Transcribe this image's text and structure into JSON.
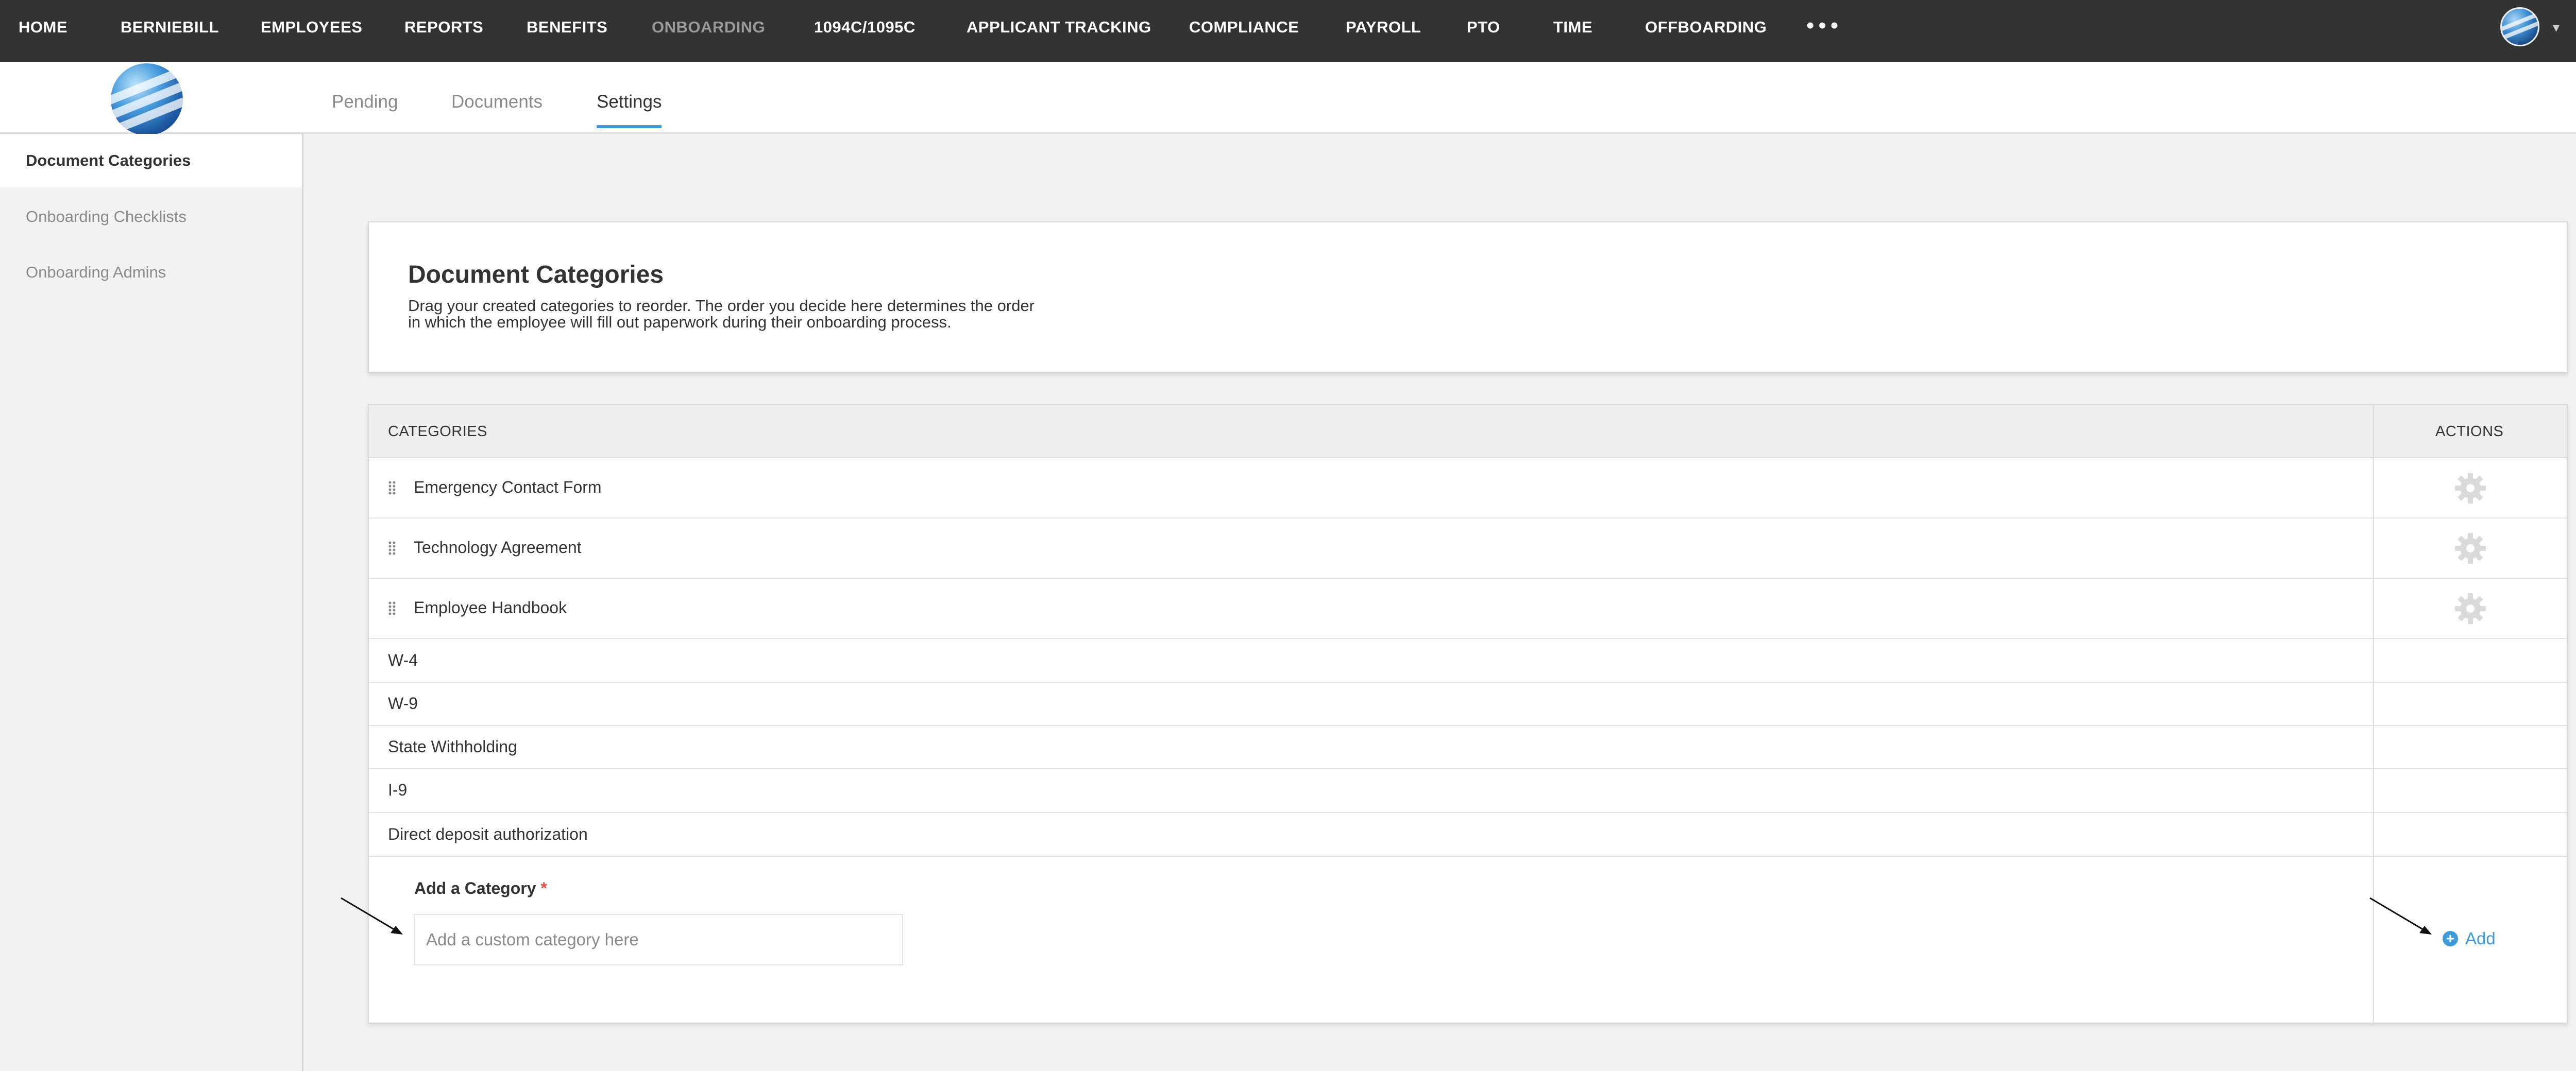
{
  "topnav": {
    "items": [
      {
        "label": "HOME"
      },
      {
        "label": "BERNIEBILL"
      },
      {
        "label": "EMPLOYEES"
      },
      {
        "label": "REPORTS"
      },
      {
        "label": "BENEFITS"
      },
      {
        "label": "ONBOARDING"
      },
      {
        "label": "1094C/1095C"
      },
      {
        "label": "APPLICANT TRACKING"
      },
      {
        "label": "COMPLIANCE"
      },
      {
        "label": "PAYROLL"
      },
      {
        "label": "PTO"
      },
      {
        "label": "TIME"
      },
      {
        "label": "OFFBOARDING"
      }
    ],
    "more": "•••",
    "active_item": "ONBOARDING",
    "caret": "▾"
  },
  "tabs": [
    {
      "label": "Pending"
    },
    {
      "label": "Documents"
    },
    {
      "label": "Settings"
    }
  ],
  "active_tab": "Settings",
  "sidebar": {
    "items": [
      {
        "label": "Document Categories"
      },
      {
        "label": "Onboarding Checklists"
      },
      {
        "label": "Onboarding Admins"
      }
    ],
    "active_item": "Document Categories"
  },
  "card": {
    "title": "Document Categories",
    "description_line1": "Drag your created categories to reorder. The order you decide here determines the order",
    "description_line2": "in which the employee will fill out paperwork during their onboarding process."
  },
  "table": {
    "header_categories": "CATEGORIES",
    "header_actions": "ACTIONS",
    "custom_rows": [
      {
        "label": "Emergency Contact Form"
      },
      {
        "label": "Technology Agreement"
      },
      {
        "label": "Employee Handbook"
      }
    ],
    "default_rows": [
      {
        "label": "W-4"
      },
      {
        "label": "W-9"
      },
      {
        "label": "State Withholding"
      },
      {
        "label": "I-9"
      },
      {
        "label": "Direct deposit authorization"
      }
    ]
  },
  "add_category": {
    "label": "Add a Category",
    "required_marker": "*",
    "placeholder": "Add a custom category here",
    "value": "",
    "button_label": "Add"
  },
  "colors": {
    "nav_bg": "#333333",
    "accent": "#3f9ad8",
    "required": "#d9534f"
  }
}
